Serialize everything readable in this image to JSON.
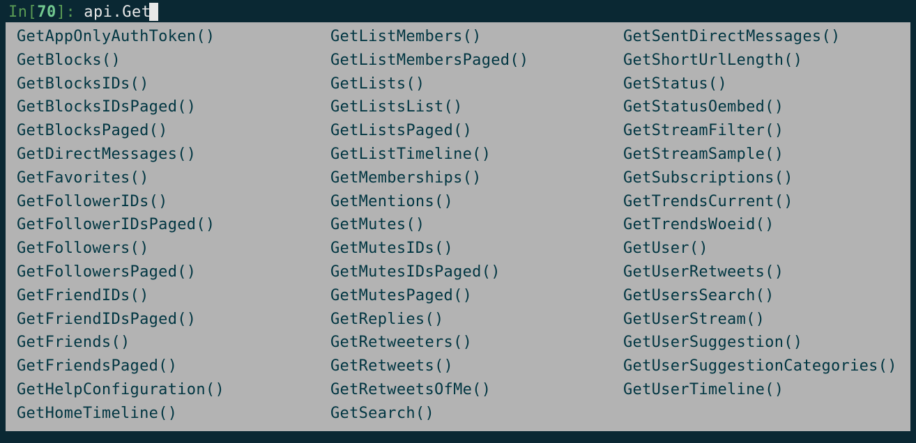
{
  "prompt": {
    "label": "In ",
    "open_bracket": "[",
    "number": "70",
    "close_bracket": "]",
    "colon": ": ",
    "input": "api.Get"
  },
  "completions": {
    "col1": [
      "GetAppOnlyAuthToken()",
      "GetBlocks()",
      "GetBlocksIDs()",
      "GetBlocksIDsPaged()",
      "GetBlocksPaged()",
      "GetDirectMessages()",
      "GetFavorites()",
      "GetFollowerIDs()",
      "GetFollowerIDsPaged()",
      "GetFollowers()",
      "GetFollowersPaged()",
      "GetFriendIDs()",
      "GetFriendIDsPaged()",
      "GetFriends()",
      "GetFriendsPaged()",
      "GetHelpConfiguration()",
      "GetHomeTimeline()"
    ],
    "col2": [
      "GetListMembers()",
      "GetListMembersPaged()",
      "GetLists()",
      "GetListsList()",
      "GetListsPaged()",
      "GetListTimeline()",
      "GetMemberships()",
      "GetMentions()",
      "GetMutes()",
      "GetMutesIDs()",
      "GetMutesIDsPaged()",
      "GetMutesPaged()",
      "GetReplies()",
      "GetRetweeters()",
      "GetRetweets()",
      "GetRetweetsOfMe()",
      "GetSearch()"
    ],
    "col3": [
      "GetSentDirectMessages()",
      "GetShortUrlLength()",
      "GetStatus()",
      "GetStatusOembed()",
      "GetStreamFilter()",
      "GetStreamSample()",
      "GetSubscriptions()",
      "GetTrendsCurrent()",
      "GetTrendsWoeid()",
      "GetUser()",
      "GetUserRetweets()",
      "GetUsersSearch()",
      "GetUserStream()",
      "GetUserSuggestion()",
      "GetUserSuggestionCategories()",
      "GetUserTimeline()"
    ]
  }
}
